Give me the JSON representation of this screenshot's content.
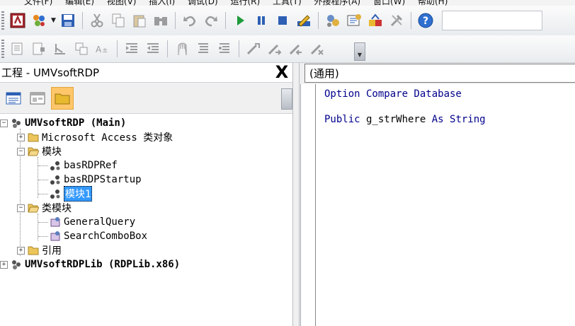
{
  "menubar": {
    "items": [
      "文件(F)",
      "编辑(E)",
      "视图(V)",
      "插入(I)",
      "调试(D)",
      "运行(R)",
      "工具(T)",
      "外接程序(A)",
      "窗口(W)",
      "帮助(H)"
    ]
  },
  "toolbar": {
    "icons": [
      "access-icon",
      "insert-module-icon",
      "save-icon",
      "cut-icon",
      "copy-icon",
      "paste-icon",
      "find-icon",
      "undo-icon",
      "redo-icon",
      "run-icon",
      "break-icon",
      "reset-icon",
      "design-mode-icon",
      "project-explorer-icon",
      "properties-icon",
      "object-browser-icon",
      "toolbox-icon",
      "help-icon"
    ]
  },
  "project_pane": {
    "title": "工程 - UMVsoftRDP",
    "close_label": "X",
    "tree": [
      {
        "label": "UMVsoftRDP (Main)",
        "expander": "−"
      },
      {
        "label": "Microsoft Access 类对象",
        "expander": "+"
      },
      {
        "label": "模块",
        "expander": "−"
      },
      {
        "label": "basRDPRef"
      },
      {
        "label": "basRDPStartup"
      },
      {
        "label": "模块1"
      },
      {
        "label": "类模块",
        "expander": "−"
      },
      {
        "label": "GeneralQuery"
      },
      {
        "label": "SearchComboBox"
      },
      {
        "label": "引用",
        "expander": "+"
      },
      {
        "label": "UMVsoftRDPLib (RDPLib.x86)",
        "expander": "+"
      }
    ]
  },
  "code_pane": {
    "object_combo": "(通用)",
    "lines": [
      {
        "kw": "Option Compare Database",
        "rest": ""
      },
      {
        "kw": "Public",
        "rest": " g_strWhere ",
        "kw2": "As String"
      }
    ]
  },
  "colors": {
    "selection": "#3399ff",
    "keyword": "#00008b",
    "active_toggle": "#ffc66a"
  }
}
